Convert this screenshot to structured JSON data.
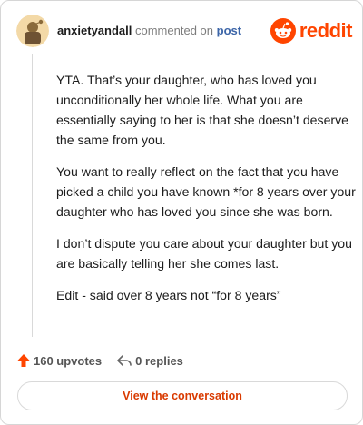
{
  "header": {
    "username": "anxietyandall",
    "action_text": "commented on",
    "post_link": "post",
    "brand": "reddit"
  },
  "comment": {
    "paragraphs": [
      "YTA. That’s your daughter, who has loved you unconditionally her whole life. What you are essentially saying to her is that she doesn’t deserve the same from you.",
      "You want to really reflect on the fact that you have picked a child you have known *for 8 years over your daughter who has loved you since she was born.",
      "I don’t dispute you care about your daughter but you are basically telling her she comes last.",
      "Edit - said over 8 years not “for 8 years”"
    ]
  },
  "footer": {
    "upvotes": "160 upvotes",
    "replies": "0 replies"
  },
  "cta": {
    "label": "View the conversation"
  },
  "colors": {
    "brand": "#ff4500",
    "upvote": "#ff4500",
    "link": "#3c65a8",
    "cta_text": "#d93a00"
  },
  "icons": [
    "snoo-avatar-icon",
    "reddit-logo-icon",
    "upvote-arrow-icon",
    "reply-arrow-icon"
  ]
}
